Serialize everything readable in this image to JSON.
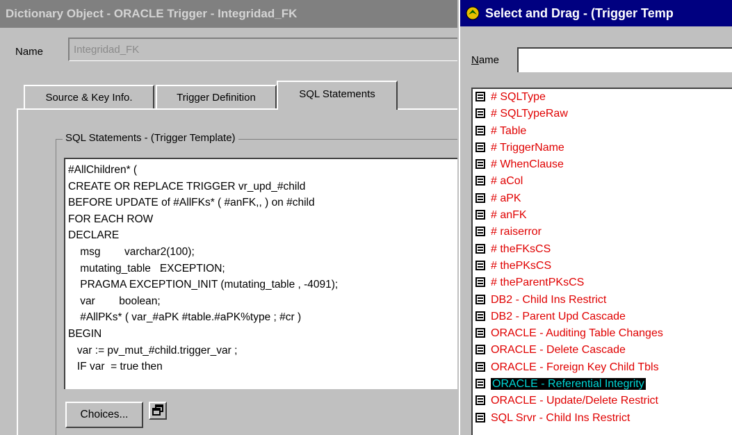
{
  "left_window": {
    "title": "Dictionary Object - ORACLE Trigger - Integridad_FK",
    "name_label": "Name",
    "name_value": "Integridad_FK",
    "tabs": [
      {
        "label": "Source & Key Info."
      },
      {
        "label": "Trigger Definition"
      },
      {
        "label": "SQL Statements",
        "active": true
      }
    ],
    "group_label": "SQL Statements - (Trigger Template)",
    "sql_lines": [
      "#AllChildren* (",
      "CREATE OR REPLACE TRIGGER vr_upd_#child",
      "BEFORE UPDATE of #AllFKs* ( #anFK,, ) on #child",
      "FOR EACH ROW",
      "DECLARE",
      "    msg        varchar2(100);",
      "    mutating_table   EXCEPTION;",
      "    PRAGMA EXCEPTION_INIT (mutating_table , -4091);",
      "    var        boolean;",
      "    #AllPKs* ( var_#aPK #table.#aPK%type ; #cr )",
      "BEGIN",
      "   var := pv_mut_#child.trigger_var ;",
      "   IF var  = true then"
    ],
    "choices_button": "Choices...",
    "restore_icon": "restore-icon"
  },
  "right_window": {
    "title": "Select and Drag - (Trigger Temp",
    "title_icon": "app-icon",
    "name_label": "Name",
    "name_value": "",
    "item_icon": "template-icon",
    "selected_index": 18,
    "colors": {
      "item_text": "#e00000",
      "selected_bg": "#000000",
      "selected_text": "#00d8d8"
    },
    "items": [
      "# SQLType",
      "# SQLTypeRaw",
      "# Table",
      "# TriggerName",
      "# WhenClause",
      "# aCol",
      "# aPK",
      "# anFK",
      "# raiserror",
      "# theFKsCS",
      "# thePKsCS",
      "# theParentPKsCS",
      "DB2 - Child Ins Restrict",
      "DB2 - Parent Upd Cascade",
      "ORACLE - Auditing Table Changes",
      "ORACLE - Delete Cascade",
      "ORACLE - Foreign Key Child Tbls",
      "ORACLE - Referential Integrity",
      "ORACLE - Update/Delete Restrict",
      "SQL Srvr - Child Ins Restrict"
    ]
  }
}
